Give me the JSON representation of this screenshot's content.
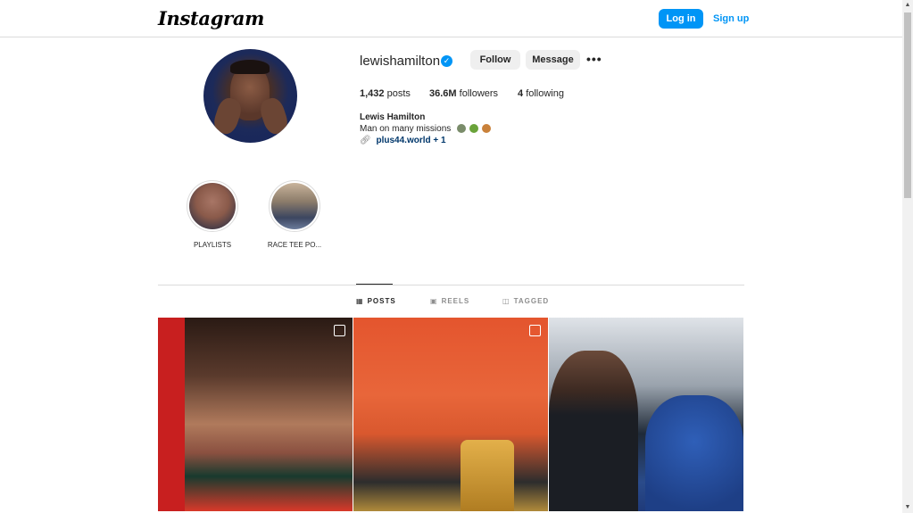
{
  "topbar": {
    "logo": "Instagram",
    "login_label": "Log in",
    "signup_label": "Sign up"
  },
  "profile": {
    "username": "lewishamilton",
    "verified_icon": "verified-badge-icon",
    "follow_label": "Follow",
    "message_label": "Message",
    "more_label": "•••",
    "stats": {
      "posts_count": "1,432",
      "posts_label": "posts",
      "followers_count": "36.6M",
      "followers_label": "followers",
      "following_count": "4",
      "following_label": "following"
    },
    "full_name": "Lewis Hamilton",
    "bio": "Man on many missions",
    "bio_emojis": [
      "ufo",
      "sprout",
      "victory-hand"
    ],
    "link_text": "plus44.world",
    "link_extra": "+ 1"
  },
  "highlights": [
    {
      "label": "PLAYLISTS"
    },
    {
      "label": "RACE TEE PO..."
    }
  ],
  "tabs": [
    {
      "label": "POSTS",
      "icon": "grid-icon",
      "active": true
    },
    {
      "label": "REELS",
      "icon": "reels-icon",
      "active": false
    },
    {
      "label": "TAGGED",
      "icon": "tagged-icon",
      "active": false
    }
  ],
  "colors": {
    "accent": "#0095f6",
    "border": "#dbdbdb",
    "text": "#262626",
    "muted": "#8e8e8e"
  }
}
